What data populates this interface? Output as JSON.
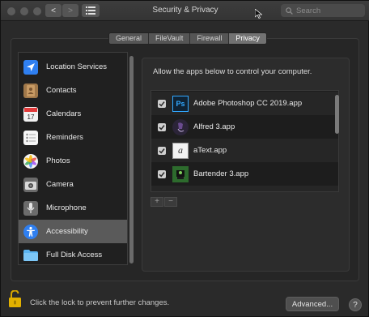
{
  "window": {
    "title": "Security & Privacy",
    "search_placeholder": "Search",
    "back_label": "<",
    "forward_label": ">"
  },
  "tabs": [
    {
      "label": "General",
      "selected": false
    },
    {
      "label": "FileVault",
      "selected": false
    },
    {
      "label": "Firewall",
      "selected": false
    },
    {
      "label": "Privacy",
      "selected": true
    }
  ],
  "sidebar": {
    "items": [
      {
        "label": "Location Services",
        "icon": "location-arrow-icon",
        "color": "#2f7ff0",
        "selected": false
      },
      {
        "label": "Contacts",
        "icon": "contacts-book-icon",
        "color": "#a0784a",
        "selected": false
      },
      {
        "label": "Calendars",
        "icon": "calendar-icon",
        "color": "#f2f2f2",
        "selected": false
      },
      {
        "label": "Reminders",
        "icon": "reminders-list-icon",
        "color": "#f6f6f6",
        "selected": false
      },
      {
        "label": "Photos",
        "icon": "photos-flower-icon",
        "color": "#f5f5f5",
        "selected": false
      },
      {
        "label": "Camera",
        "icon": "camera-icon",
        "color": "#6b6b6b",
        "selected": false
      },
      {
        "label": "Microphone",
        "icon": "microphone-icon",
        "color": "#6b6b6b",
        "selected": false
      },
      {
        "label": "Accessibility",
        "icon": "accessibility-person-icon",
        "color": "#2f7ff0",
        "selected": true
      },
      {
        "label": "Full Disk Access",
        "icon": "folder-icon",
        "color": "#5bb4f0",
        "selected": false
      }
    ]
  },
  "main": {
    "instruction": "Allow the apps below to control your computer.",
    "apps": [
      {
        "name": "Adobe Photoshop CC 2019.app",
        "checked": true,
        "icon": "photoshop-icon",
        "color": "#0f2233"
      },
      {
        "name": "Alfred 3.app",
        "checked": true,
        "icon": "alfred-hat-icon",
        "color": "#2b2438"
      },
      {
        "name": "aText.app",
        "checked": true,
        "icon": "atext-icon",
        "color": "#f2f2f2"
      },
      {
        "name": "Bartender 3.app",
        "checked": true,
        "icon": "bartender-icon",
        "color": "#2d6b2d"
      }
    ],
    "add_label": "+",
    "remove_label": "−"
  },
  "footer": {
    "lock_text": "Click the lock to prevent further changes.",
    "advanced_label": "Advanced...",
    "help_label": "?"
  },
  "colors": {
    "accent_blue": "#2f7ff0",
    "selection": "#5a5a5a",
    "lock_gold": "#e2b100"
  }
}
